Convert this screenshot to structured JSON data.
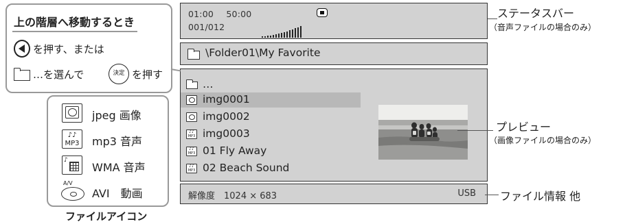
{
  "status_bar": {
    "mode": "01:00",
    "elapsed": "50:00",
    "counter": "001/012",
    "stop_icon": "stop-icon"
  },
  "path_bar": {
    "path": "\\Folder01\\My Favorite",
    "icon": "folder-icon"
  },
  "file_list": {
    "parent": "…",
    "items": [
      {
        "name": "img0001",
        "icon": "jpeg-icon",
        "selected": true
      },
      {
        "name": "img0002",
        "icon": "jpeg-icon",
        "selected": false
      },
      {
        "name": "img0003",
        "icon": "mp3-icon",
        "selected": false
      },
      {
        "name": "01 Fly Away",
        "icon": "mp3-icon",
        "selected": false
      },
      {
        "name": "02 Beach Sound",
        "icon": "mp3-icon",
        "selected": false
      }
    ]
  },
  "info_bar": {
    "resolution": "解像度　1024 × 683",
    "source": "USB"
  },
  "callouts": {
    "status": "ステータスバー",
    "status_note": "（音声ファイルの場合のみ）",
    "preview": "プレビュー",
    "preview_note": "（画像ファイルの場合のみ）",
    "file_info": "ファイル情報 他"
  },
  "nav_help": {
    "title": "上の階層へ移動するとき",
    "line2": "を押す、または",
    "line3a": "…を選んで",
    "enter_label": "決定",
    "line3b": "を押す"
  },
  "legend": {
    "items": [
      {
        "label": "jpeg 画像",
        "icon": "jpeg-icon"
      },
      {
        "label": "mp3 音声",
        "icon": "mp3-icon"
      },
      {
        "label": "WMA 音声",
        "icon": "wma-icon"
      },
      {
        "label": "AVI　動画",
        "icon": "avi-icon"
      }
    ],
    "caption": "ファイルアイコン",
    "mp3_text": "MP3",
    "av_text": "A/V"
  },
  "colors": {
    "panel": "#d2d2d2",
    "selected_row": "#b8b8b8",
    "border": "#333333"
  }
}
